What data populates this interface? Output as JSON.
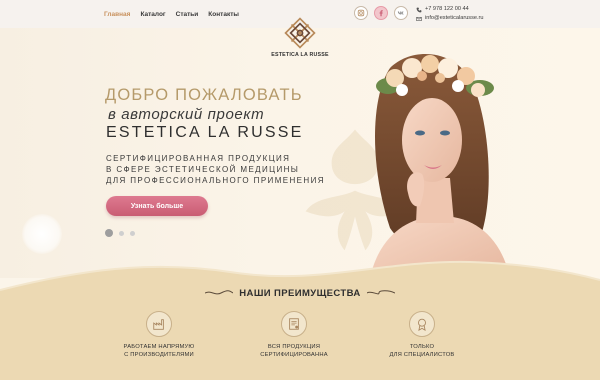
{
  "nav": [
    {
      "label": "Главная",
      "active": true
    },
    {
      "label": "Каталог",
      "active": false
    },
    {
      "label": "Статьи",
      "active": false
    },
    {
      "label": "Контакты",
      "active": false
    }
  ],
  "socials": [
    {
      "icon": "instagram-icon"
    },
    {
      "icon": "facebook-icon",
      "active": true
    },
    {
      "icon": "vk-icon"
    }
  ],
  "contacts": {
    "phone": "+7 978 122 00 44",
    "email": "info@esteticalarusse.ru"
  },
  "logo": {
    "text": "ESTETICA LA RUSSE"
  },
  "hero": {
    "welcome": "ДОБРО ПОЖАЛОВАТЬ",
    "line2": "в авторский проект",
    "brand": "ESTETICA LA RUSSE",
    "subtitle_lines": [
      "СЕРТИФИЦИРОВАННАЯ ПРОДУКЦИЯ",
      "В СФЕРЕ ЭСТЕТИЧЕСКОЙ МЕДИЦИНЫ",
      "ДЛЯ ПРОФЕССИОНАЛЬНОГО ПРИМЕНЕНИЯ"
    ],
    "cta": "Узнать больше",
    "slides_total": 3,
    "slide_active": 1
  },
  "advantages": {
    "title": "НАШИ ПРЕИМУЩЕСТВА",
    "items": [
      {
        "icon": "factory-icon",
        "line1": "РАБОТАЕМ НАПРЯМУЮ",
        "line2": "С ПРОИЗВОДИТЕЛЯМИ"
      },
      {
        "icon": "certificate-icon",
        "line1": "ВСЯ ПРОДУКЦИЯ",
        "line2": "СЕРТИФИЦИРОВАННА"
      },
      {
        "icon": "award-icon",
        "line1": "ТОЛЬКО",
        "line2": "ДЛЯ СПЕЦИАЛИСТОВ"
      }
    ]
  },
  "colors": {
    "accent_gold": "#b59a6a",
    "nav_active": "#c9925e",
    "cta_pink": "#d46a81",
    "sand": "#ecd9b3"
  }
}
